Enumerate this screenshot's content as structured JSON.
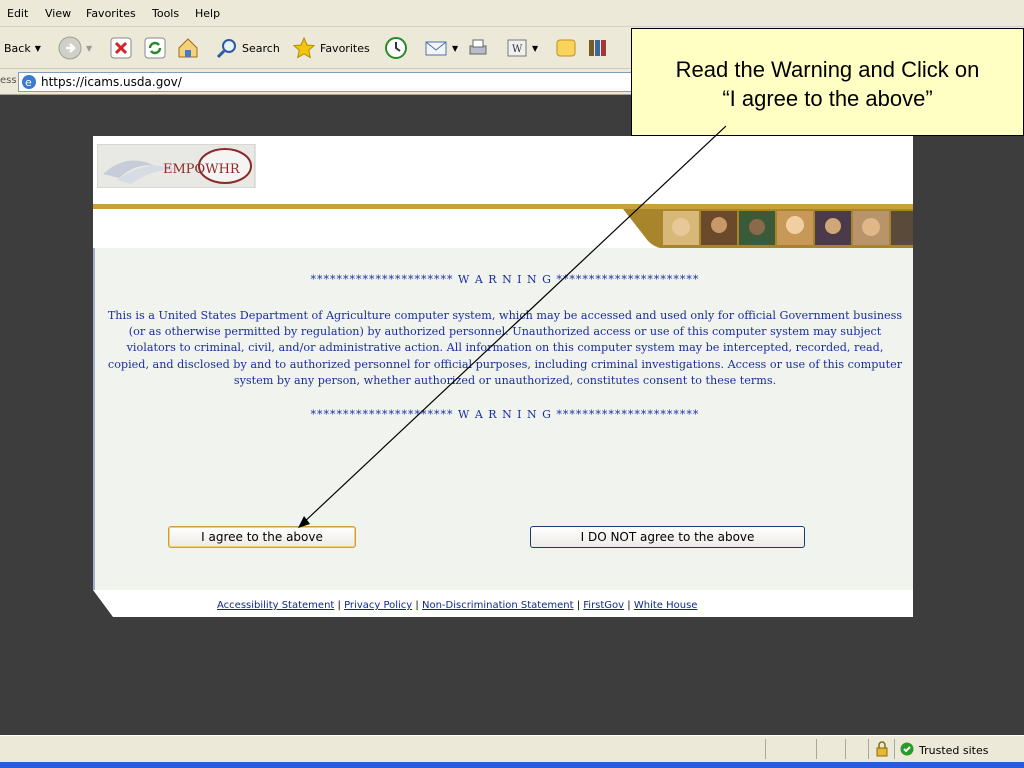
{
  "menu": {
    "items": [
      "Edit",
      "View",
      "Favorites",
      "Tools",
      "Help"
    ]
  },
  "toolbar": {
    "back_label": "Back",
    "search_label": "Search",
    "favorites_label": "Favorites"
  },
  "address": {
    "prefix": "ess",
    "url": "https://icams.usda.gov/"
  },
  "page": {
    "logo_text": "EMPOWHR",
    "warning_banner": "********************** W A R N I N G **********************",
    "warning_text": "This is a United States Department of Agriculture computer system, which may be accessed and used only for official Government business (or as otherwise permitted by regulation) by authorized personnel. Unauthorized access or use of this computer system may subject violators to criminal, civil, and/or administrative action. All information on this computer system may be intercepted, recorded, read, copied, and disclosed by and to authorized personnel for official purposes, including criminal investigations. Access or use of this computer system by any person, whether authorized or unauthorized, constitutes consent to these terms.",
    "agree_button": "I agree to the above",
    "disagree_button": "I DO NOT agree to the above",
    "footer_links": [
      "Accessibility Statement",
      "Privacy Policy",
      "Non-Discrimination Statement",
      "FirstGov",
      "White House"
    ]
  },
  "callout": {
    "line1": "Read the Warning and Click on",
    "line2": "“I agree to the above”"
  },
  "status": {
    "zone": "Trusted sites"
  },
  "colors": {
    "warning_text": "#1a2ea0",
    "callout_bg": "#ffffc4",
    "accent_gold": "#c8a13a"
  }
}
